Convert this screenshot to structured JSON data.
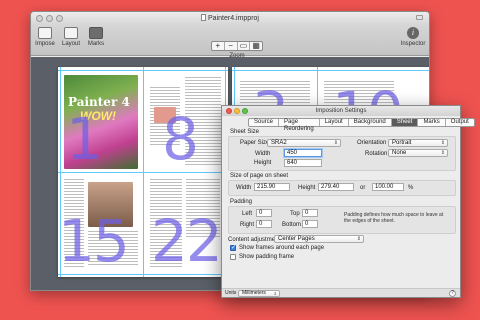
{
  "window": {
    "title": "Painter4.impproj",
    "toolbar": {
      "preview_label": "Impose",
      "layout_label": "Layout",
      "marks_label": "Marks",
      "zoom_label": "Zoom",
      "zoom_in": "+",
      "zoom_out": "−",
      "zoom_fit": "▭",
      "zoom_fill": "▦",
      "inspector_label": "Inspector",
      "inspector_glyph": "i"
    },
    "pages": {
      "n1": "1",
      "n8": "8",
      "n15": "15",
      "n22": "22",
      "n3": "3",
      "n10": "10"
    },
    "cover": {
      "line1": "Painter 4",
      "line2": "WOW!"
    }
  },
  "dialog": {
    "title": "Imposition Settings",
    "tabs": [
      "Source",
      "Page Reordering",
      "Layout",
      "Background",
      "Sheet",
      "Marks",
      "Output"
    ],
    "active_tab": "Sheet",
    "sheet_size": {
      "label": "Sheet Size",
      "paper_size_label": "Paper Size",
      "paper_size_value": "SRA2",
      "orientation_label": "Orientation",
      "orientation_value": "Portrait",
      "rotation_label": "Rotation",
      "rotation_value": "None",
      "width_label": "Width",
      "width_value": "450",
      "height_label": "Height",
      "height_value": "640"
    },
    "page_size": {
      "label": "Size of page on sheet",
      "width_label": "Width",
      "width_value": "215.90",
      "height_label": "Height",
      "height_value": "279.40",
      "or_label": "or",
      "percent_value": "100.00",
      "percent_unit": "%"
    },
    "padding": {
      "label": "Padding",
      "left_label": "Left",
      "left_value": "0",
      "top_label": "Top",
      "top_value": "0",
      "right_label": "Right",
      "right_value": "0",
      "bottom_label": "Bottom",
      "bottom_value": "0",
      "note": "Padding defines how much space to leave at the edges of the sheet."
    },
    "content_adjustment_label": "Content adjustment",
    "content_adjustment_value": "Center Pages",
    "show_frames_label": "Show frames around each page",
    "show_frames_checked": true,
    "show_padding_label": "Show padding frame",
    "show_padding_checked": false,
    "units_label": "Units",
    "units_value": "Millimeters",
    "help_glyph": "?"
  }
}
